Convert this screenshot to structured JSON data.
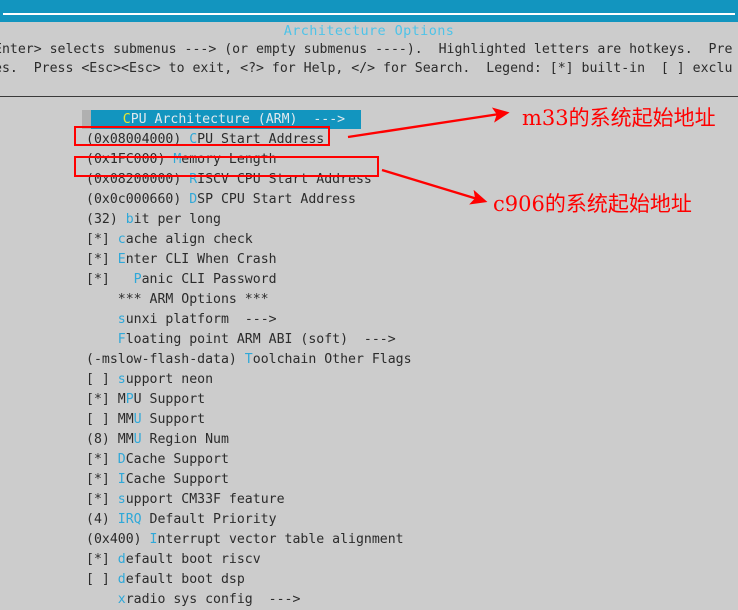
{
  "window": {
    "top_bar_color": "#1295bf",
    "background_color": "#cccccc"
  },
  "dialog": {
    "title": "Architecture Options",
    "title_color": "#4ec3e8",
    "help_line_1": "Enter> selects submenus ---> (or empty submenus ----).  Highlighted letters are hotkeys.  Pre",
    "help_line_2": "es.  Press <Esc><Esc> to exit, <?> for Help, </> for Search.  Legend: [*] built-in  [ ] exclu"
  },
  "menu": {
    "selected_index": 0,
    "selected_bg_color": "#1295bf",
    "hotkey_color": "#2fa8d8",
    "selected_hotkey_color": "#e8e830",
    "items": [
      {
        "prefix": "",
        "hot": "C",
        "rest": "PU Architecture (ARM)",
        "arrow": "  --->",
        "selected": true
      },
      {
        "prefix": "(0x08004000) ",
        "hot": "C",
        "rest": "PU Start Address",
        "arrow": ""
      },
      {
        "prefix": "(0x1FC000) ",
        "hot": "M",
        "rest": "emory Length",
        "arrow": ""
      },
      {
        "prefix": "(0x08200000) ",
        "hot": "R",
        "rest": "ISCV CPU Start Address",
        "arrow": ""
      },
      {
        "prefix": "(0x0c000660) ",
        "hot": "D",
        "rest": "SP CPU Start Address",
        "arrow": ""
      },
      {
        "prefix": "(32) ",
        "hot": "b",
        "rest": "it per long",
        "arrow": ""
      },
      {
        "prefix": "[*] ",
        "hot": "c",
        "rest": "ache align check",
        "arrow": ""
      },
      {
        "prefix": "[*] ",
        "hot": "E",
        "rest": "nter CLI When Crash",
        "arrow": ""
      },
      {
        "prefix": "[*]   ",
        "hot": "P",
        "rest": "anic CLI Password",
        "arrow": ""
      },
      {
        "prefix": "    ",
        "hot": "",
        "rest": "*** ARM Options ***",
        "arrow": ""
      },
      {
        "prefix": "    ",
        "hot": "s",
        "rest": "unxi platform",
        "arrow": "  --->"
      },
      {
        "prefix": "    ",
        "hot": "F",
        "rest": "loating point ARM ABI (soft)",
        "arrow": "  --->"
      },
      {
        "prefix": "(-mslow-flash-data) ",
        "hot": "T",
        "rest": "oolchain Other Flags",
        "arrow": ""
      },
      {
        "prefix": "[ ] ",
        "hot": "s",
        "rest": "upport neon",
        "arrow": ""
      },
      {
        "prefix": "[*] M",
        "hot": "P",
        "rest": "U Support",
        "arrow": ""
      },
      {
        "prefix": "[ ] MM",
        "hot": "U",
        "rest": " Support",
        "arrow": ""
      },
      {
        "prefix": "(8) MM",
        "hot": "U",
        "rest": " Region Num",
        "arrow": ""
      },
      {
        "prefix": "[*] ",
        "hot": "D",
        "rest": "Cache Support",
        "arrow": ""
      },
      {
        "prefix": "[*] ",
        "hot": "I",
        "rest": "Cache Support",
        "arrow": ""
      },
      {
        "prefix": "[*] ",
        "hot": "s",
        "rest": "upport CM33F feature",
        "arrow": ""
      },
      {
        "prefix": "(4) ",
        "hot": "IRQ",
        "rest": " Default Priority",
        "arrow": ""
      },
      {
        "prefix": "(0x400) ",
        "hot": "I",
        "rest": "nterrupt vector table alignment",
        "arrow": ""
      },
      {
        "prefix": "[*] ",
        "hot": "d",
        "rest": "efault boot riscv",
        "arrow": ""
      },
      {
        "prefix": "[ ] ",
        "hot": "d",
        "rest": "efault boot dsp",
        "arrow": ""
      },
      {
        "prefix": "    ",
        "hot": "x",
        "rest": "radio sys config",
        "arrow": "  --->"
      }
    ]
  },
  "annotations": {
    "color": "#ff0000",
    "label_1": "m33的系统起始地址",
    "label_2": "c906的系统起始地址",
    "box_1_target": "(0x08004000) CPU Start Address",
    "box_2_target": "(0x08200000) RISCV CPU Start Address"
  }
}
